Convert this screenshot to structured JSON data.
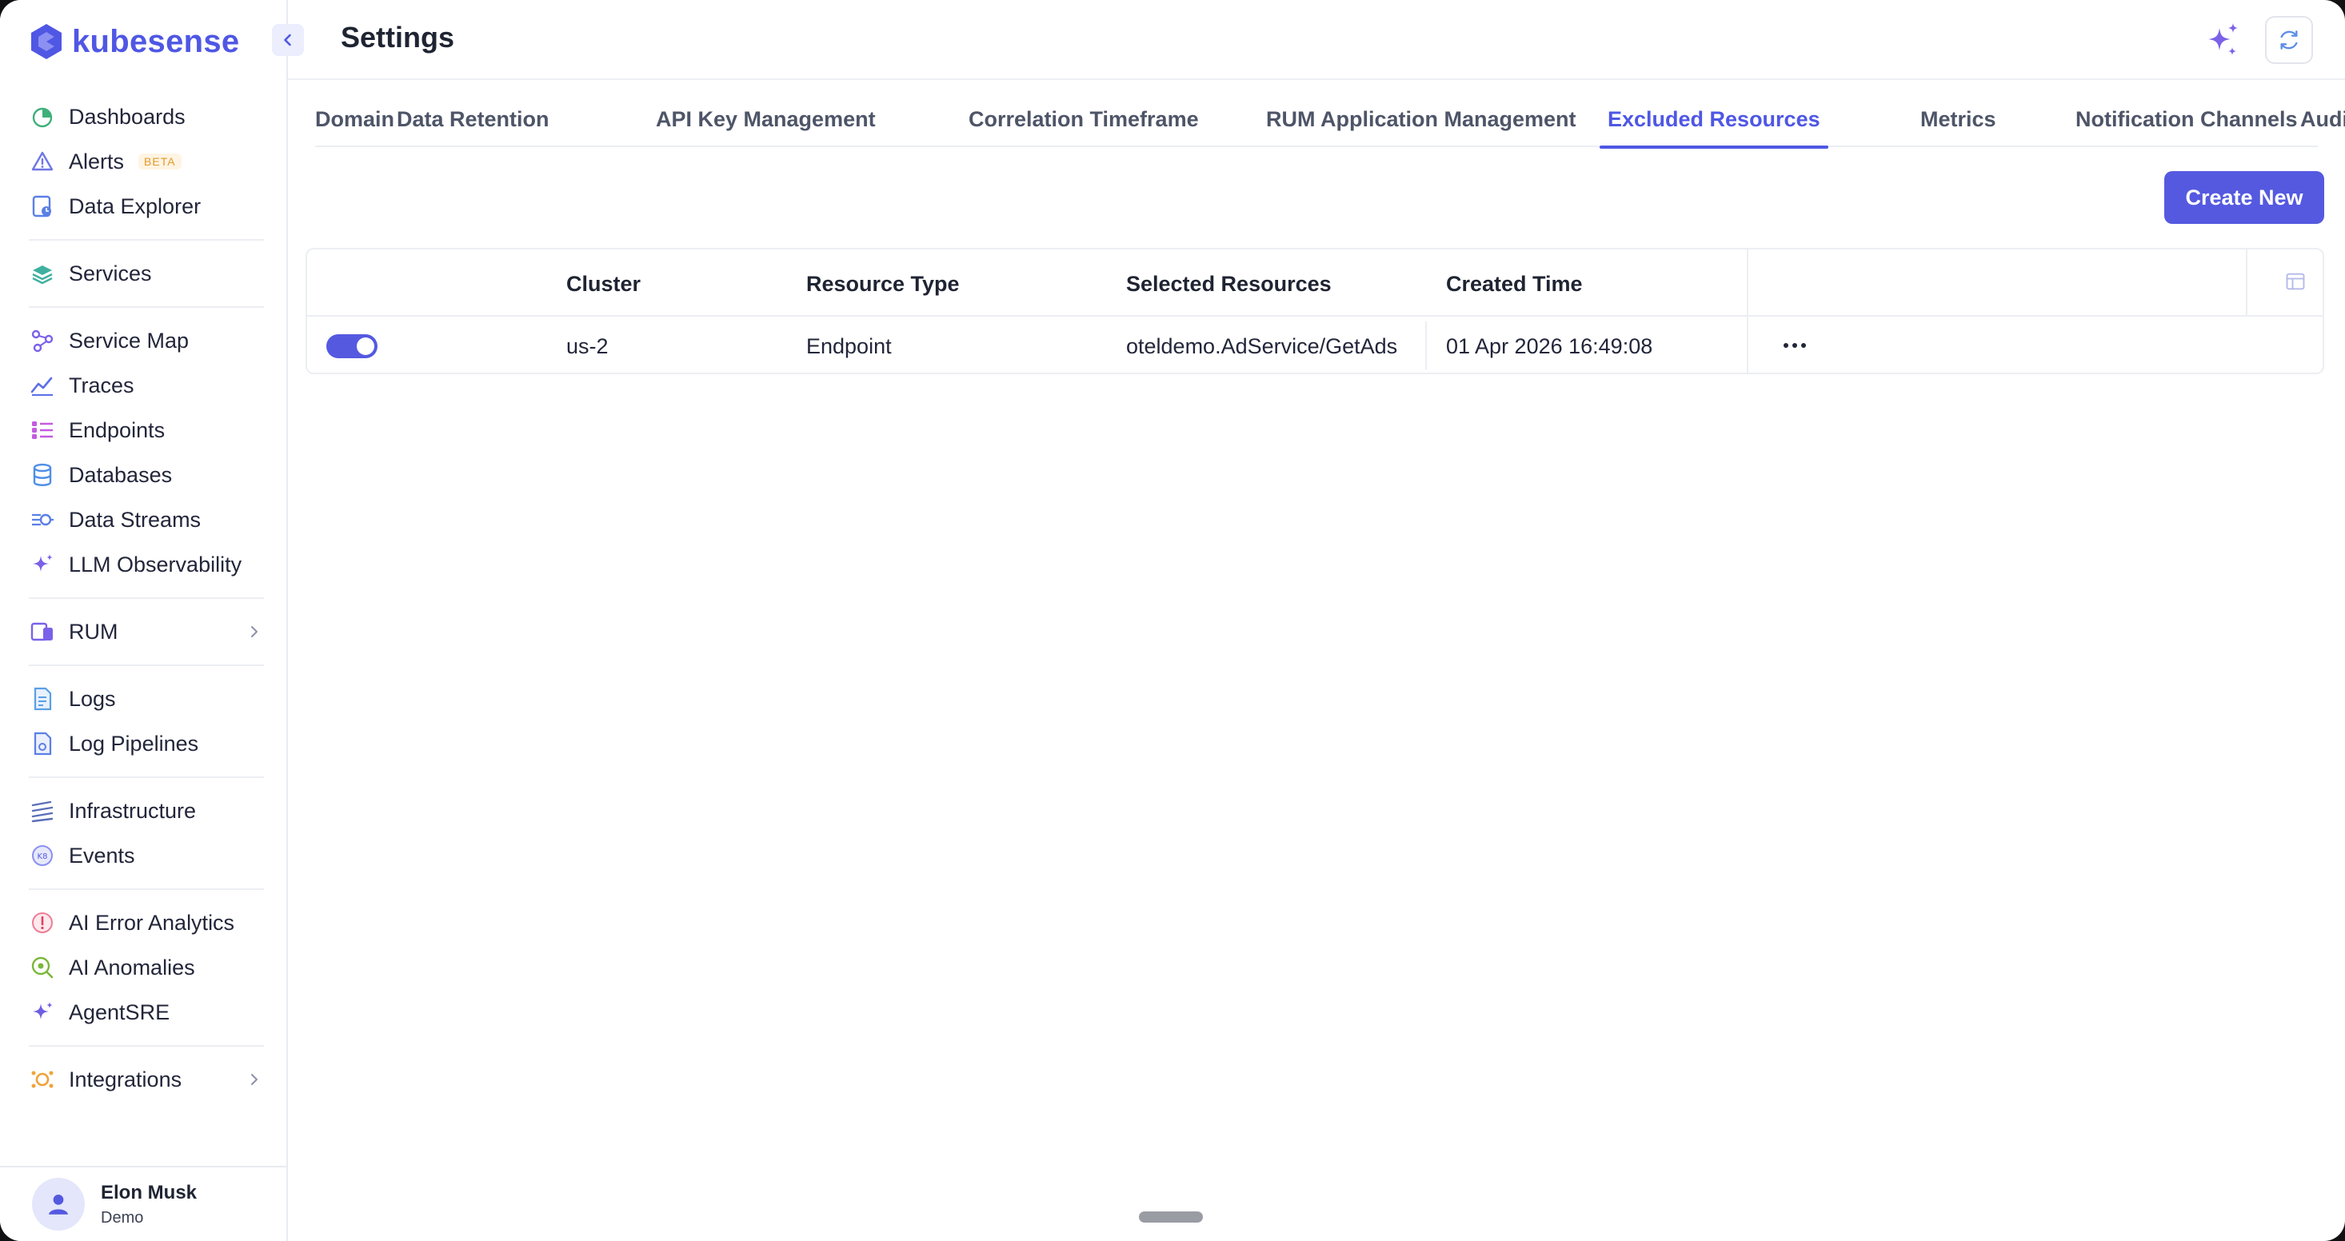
{
  "app": {
    "brand": "kubesense"
  },
  "sidebar": {
    "groups": [
      [
        {
          "label": "Dashboards",
          "icon": "dashboard-icon"
        },
        {
          "label": "Alerts",
          "icon": "alert-icon",
          "badge": "BETA"
        },
        {
          "label": "Data Explorer",
          "icon": "data-explorer-icon"
        }
      ],
      [
        {
          "label": "Services",
          "icon": "services-icon"
        }
      ],
      [
        {
          "label": "Service Map",
          "icon": "service-map-icon"
        },
        {
          "label": "Traces",
          "icon": "traces-icon"
        },
        {
          "label": "Endpoints",
          "icon": "endpoints-icon"
        },
        {
          "label": "Databases",
          "icon": "database-icon"
        },
        {
          "label": "Data Streams",
          "icon": "data-streams-icon"
        },
        {
          "label": "LLM Observability",
          "icon": "sparkle-icon"
        }
      ],
      [
        {
          "label": "RUM",
          "icon": "rum-icon",
          "expandable": true
        }
      ],
      [
        {
          "label": "Logs",
          "icon": "logs-icon"
        },
        {
          "label": "Log Pipelines",
          "icon": "log-pipelines-icon"
        }
      ],
      [
        {
          "label": "Infrastructure",
          "icon": "infrastructure-icon"
        },
        {
          "label": "Events",
          "icon": "events-icon"
        }
      ],
      [
        {
          "label": "AI Error Analytics",
          "icon": "error-analytics-icon"
        },
        {
          "label": "AI Anomalies",
          "icon": "anomalies-icon"
        },
        {
          "label": "AgentSRE",
          "icon": "agent-sre-icon"
        }
      ],
      [
        {
          "label": "Integrations",
          "icon": "integrations-icon",
          "expandable": true
        }
      ]
    ],
    "user": {
      "name": "Elon Musk",
      "role": "Demo"
    }
  },
  "header": {
    "title": "Settings"
  },
  "tabs": [
    {
      "label": "Domain",
      "active": false
    },
    {
      "label": "Data Retention",
      "active": false
    },
    {
      "label": "API Key Management",
      "active": false
    },
    {
      "label": "Correlation Timeframe",
      "active": false
    },
    {
      "label": "RUM Application Management",
      "active": false
    },
    {
      "label": "Excluded Resources",
      "active": true
    },
    {
      "label": "Metrics",
      "active": false
    },
    {
      "label": "Notification Channels",
      "active": false
    },
    {
      "label": "Audit Logs",
      "active": false
    }
  ],
  "actions": {
    "create_label": "Create New"
  },
  "table": {
    "columns": [
      "",
      "Cluster",
      "Resource Type",
      "Selected Resources",
      "Created Time"
    ],
    "rows": [
      {
        "enabled": true,
        "cluster": "us-2",
        "resource_type": "Endpoint",
        "selected_resources": "oteldemo.AdService/GetAds",
        "created_time": "01 Apr 2026 16:49:08"
      }
    ]
  },
  "colors": {
    "accent": "#4f57e4",
    "button": "#5459e0",
    "border": "#eceef3"
  }
}
